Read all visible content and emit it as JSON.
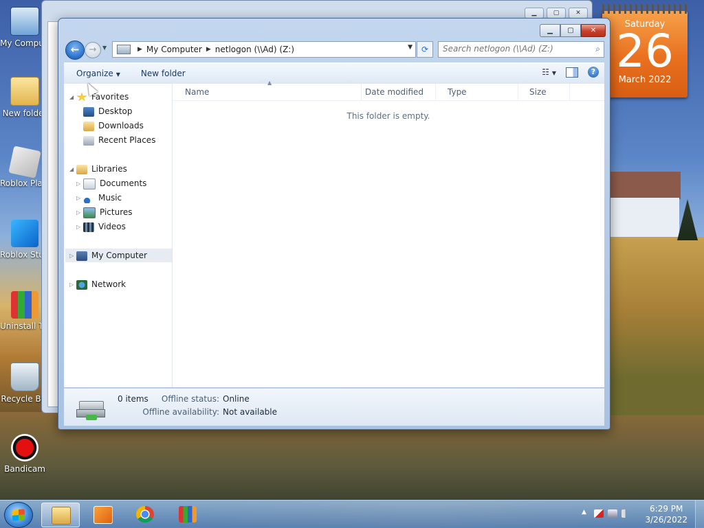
{
  "desktop": {
    "icons": [
      {
        "label": "My Computer",
        "icon": "my-computer-icon"
      },
      {
        "label": "New folder",
        "icon": "folder-icon"
      },
      {
        "label": "Roblox Player",
        "icon": "roblox-player-icon"
      },
      {
        "label": "Roblox Studio",
        "icon": "roblox-studio-icon"
      },
      {
        "label": "Uninstall Tool",
        "icon": "uninstall-tool-icon"
      },
      {
        "label": "Recycle Bin",
        "icon": "recycle-bin-icon"
      },
      {
        "label": "Bandicam",
        "icon": "bandicam-icon"
      }
    ]
  },
  "calendar": {
    "day_name": "Saturday",
    "day_number": "26",
    "month_year": "March 2022"
  },
  "window": {
    "address": {
      "segments": [
        "My Computer",
        "netlogon (\\\\Ad) (Z:)"
      ]
    },
    "search": {
      "placeholder": "Search netlogon (\\\\Ad) (Z:)"
    },
    "toolbar": {
      "organize_label": "Organize",
      "new_folder_label": "New folder"
    },
    "nav": {
      "favorites": "Favorites",
      "desktop": "Desktop",
      "downloads": "Downloads",
      "recent_places": "Recent Places",
      "libraries": "Libraries",
      "documents": "Documents",
      "music": "Music",
      "pictures": "Pictures",
      "videos": "Videos",
      "my_computer": "My Computer",
      "network": "Network"
    },
    "columns": {
      "name": "Name",
      "date_modified": "Date modified",
      "type": "Type",
      "size": "Size"
    },
    "empty_message": "This folder is empty.",
    "details": {
      "items": "0 items",
      "offline_status_label": "Offline status:",
      "offline_status_value": "Online",
      "offline_availability_label": "Offline availability:",
      "offline_availability_value": "Not available"
    }
  },
  "taskbar": {
    "clock_time": "6:29 PM",
    "clock_date": "3/26/2022"
  },
  "colors": {
    "accent": "#2a6fc8",
    "calendar_orange": "#e8701e",
    "close_red": "#c8402a"
  }
}
